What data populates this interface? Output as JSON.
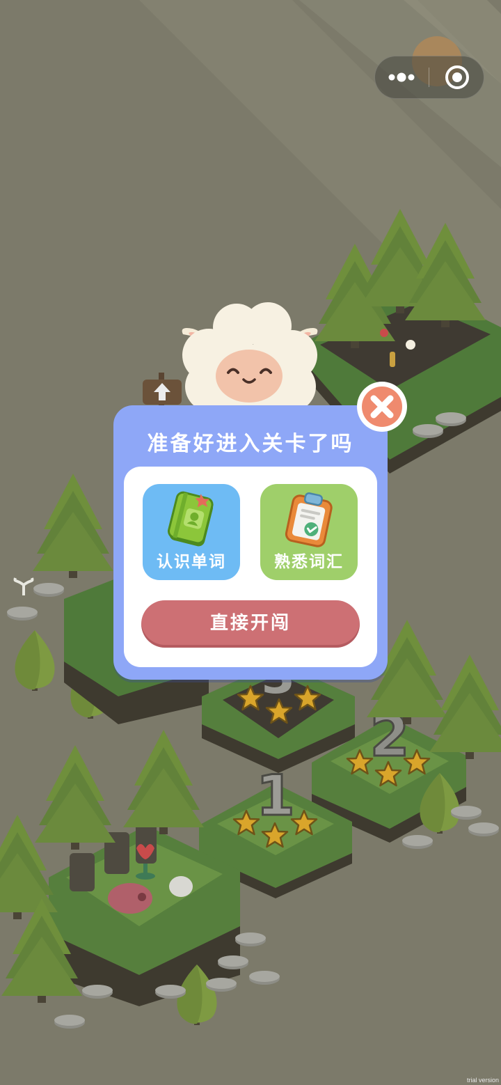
{
  "menu": {
    "more_icon": "more-dots-icon",
    "close_icon": "target-circle-icon"
  },
  "dialog": {
    "title": "准备好进入关卡了吗",
    "close_icon": "close-x-icon",
    "modes": [
      {
        "label": "认识单词",
        "icon": "green-book-icon",
        "color": "#6ebbf4"
      },
      {
        "label": "熟悉词汇",
        "icon": "clipboard-check-icon",
        "color": "#9fcf6a"
      }
    ],
    "start_label": "直接开闯",
    "start_color": "#cd7074",
    "accent_color": "#8ea7f7"
  },
  "levels": [
    {
      "number": "1",
      "stars": 3
    },
    {
      "number": "2",
      "stars": 3
    },
    {
      "number": "3",
      "stars": 3
    }
  ],
  "watermark": "trial version"
}
